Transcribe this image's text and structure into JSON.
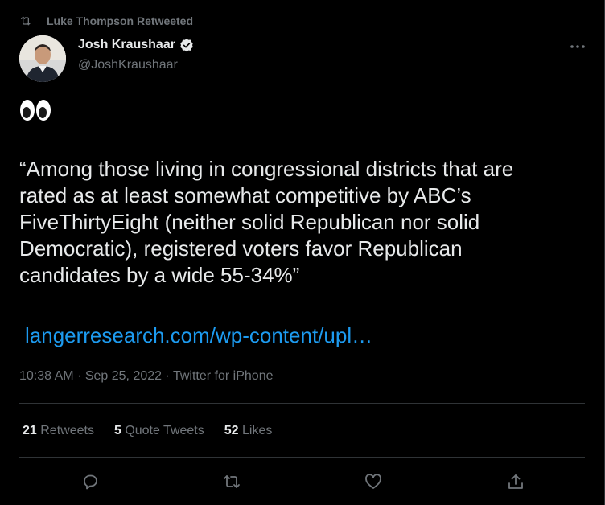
{
  "retweet": {
    "label": "Luke Thompson Retweeted",
    "icon": "retweet-icon"
  },
  "author": {
    "name": "Josh Kraushaar",
    "handle": "@JoshKraushaar",
    "verified": true
  },
  "tweet": {
    "emoji": "👀",
    "text": "“Among those living in congressional districts that are\nrated as at least somewhat competitive by ABC’s\nFiveThirtyEight (neither solid Republican nor solid\nDemocratic), registered voters favor Republican\ncandidates by a wide 55-34%”",
    "link": "langerresearch.com/wp-content/upl…",
    "time": "10:38 AM",
    "date": "Sep 25, 2022",
    "source": "Twitter for iPhone",
    "separator": "·"
  },
  "stats": {
    "retweets_count": "21",
    "retweets_label": "Retweets",
    "quotes_count": "5",
    "quotes_label": "Quote Tweets",
    "likes_count": "52",
    "likes_label": "Likes"
  },
  "colors": {
    "background": "#000000",
    "text": "#e7e9ea",
    "muted": "#71767b",
    "link": "#1d9bf0",
    "divider": "#2f3336"
  },
  "actions": [
    "reply-icon",
    "retweet-icon",
    "like-icon",
    "share-icon"
  ]
}
